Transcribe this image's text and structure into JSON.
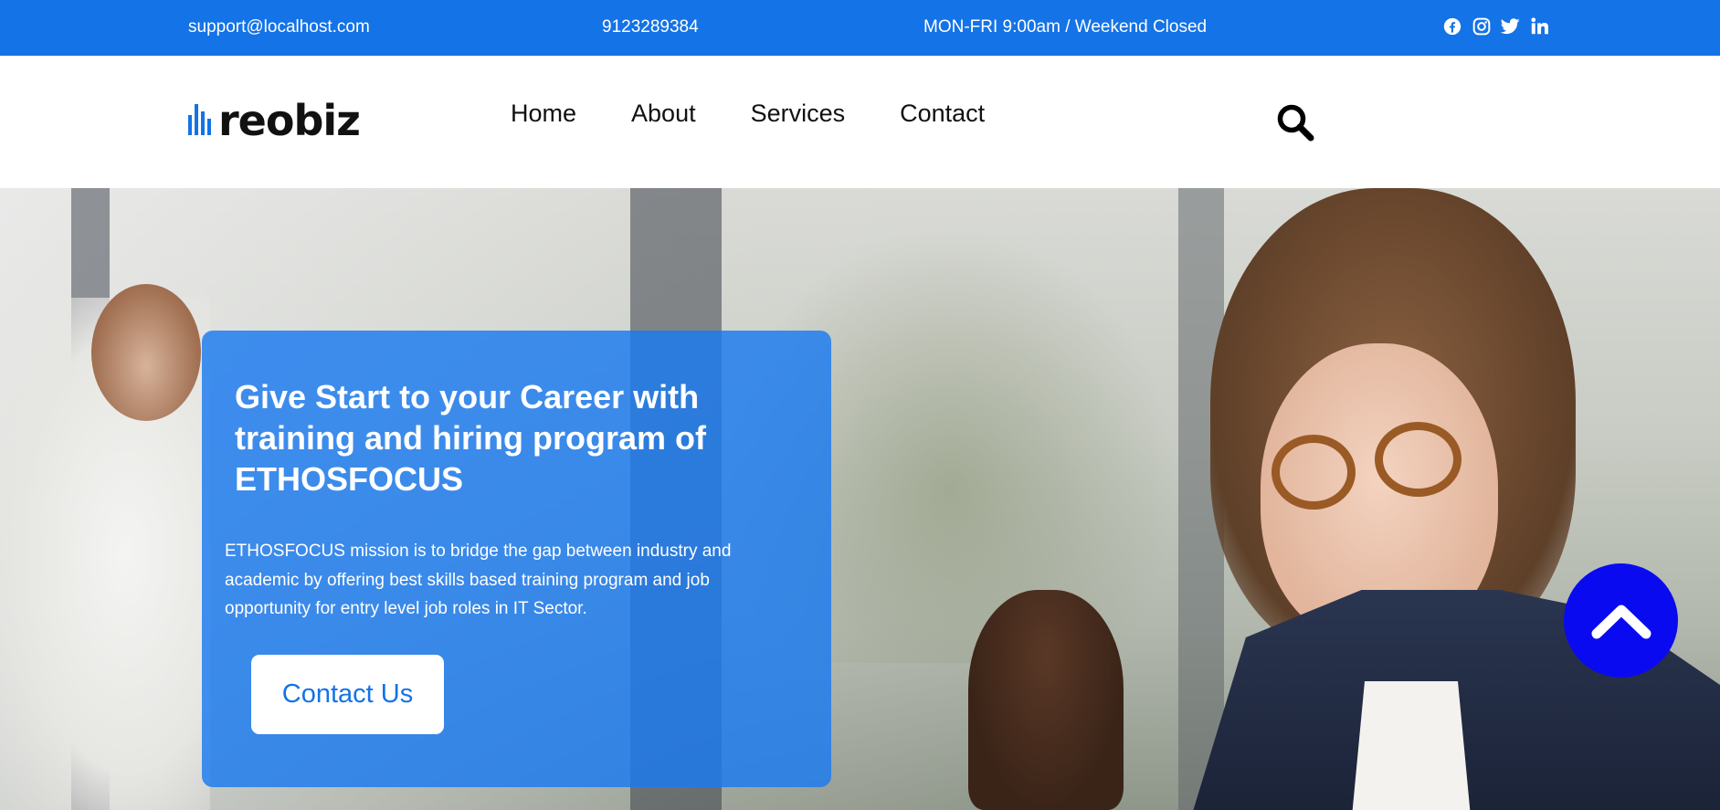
{
  "topbar": {
    "email": "support@localhost.com",
    "phone": "9123289384",
    "hours": "MON-FRI 9:00am / Weekend Closed",
    "social_icons": [
      "facebook-icon",
      "instagram-icon",
      "twitter-icon",
      "linkedin-icon"
    ]
  },
  "header": {
    "logo_text": "reobiz",
    "nav": [
      "Home",
      "About",
      "Services",
      "Contact"
    ],
    "search_icon": "search-icon"
  },
  "hero": {
    "heading": "Give Start to your Career with training and hiring program of ETHOSFOCUS",
    "description": "ETHOSFOCUS mission is to bridge the gap between industry and academic by offering best skills based training program and job opportunity for entry level job roles in IT Sector.",
    "cta_label": "Contact Us"
  },
  "scroll_to_top_icon": "chevron-up-icon",
  "colors": {
    "brand_blue": "#1473e6",
    "card_blue": "#1a7af0",
    "scroll_button": "#0a0af0"
  }
}
